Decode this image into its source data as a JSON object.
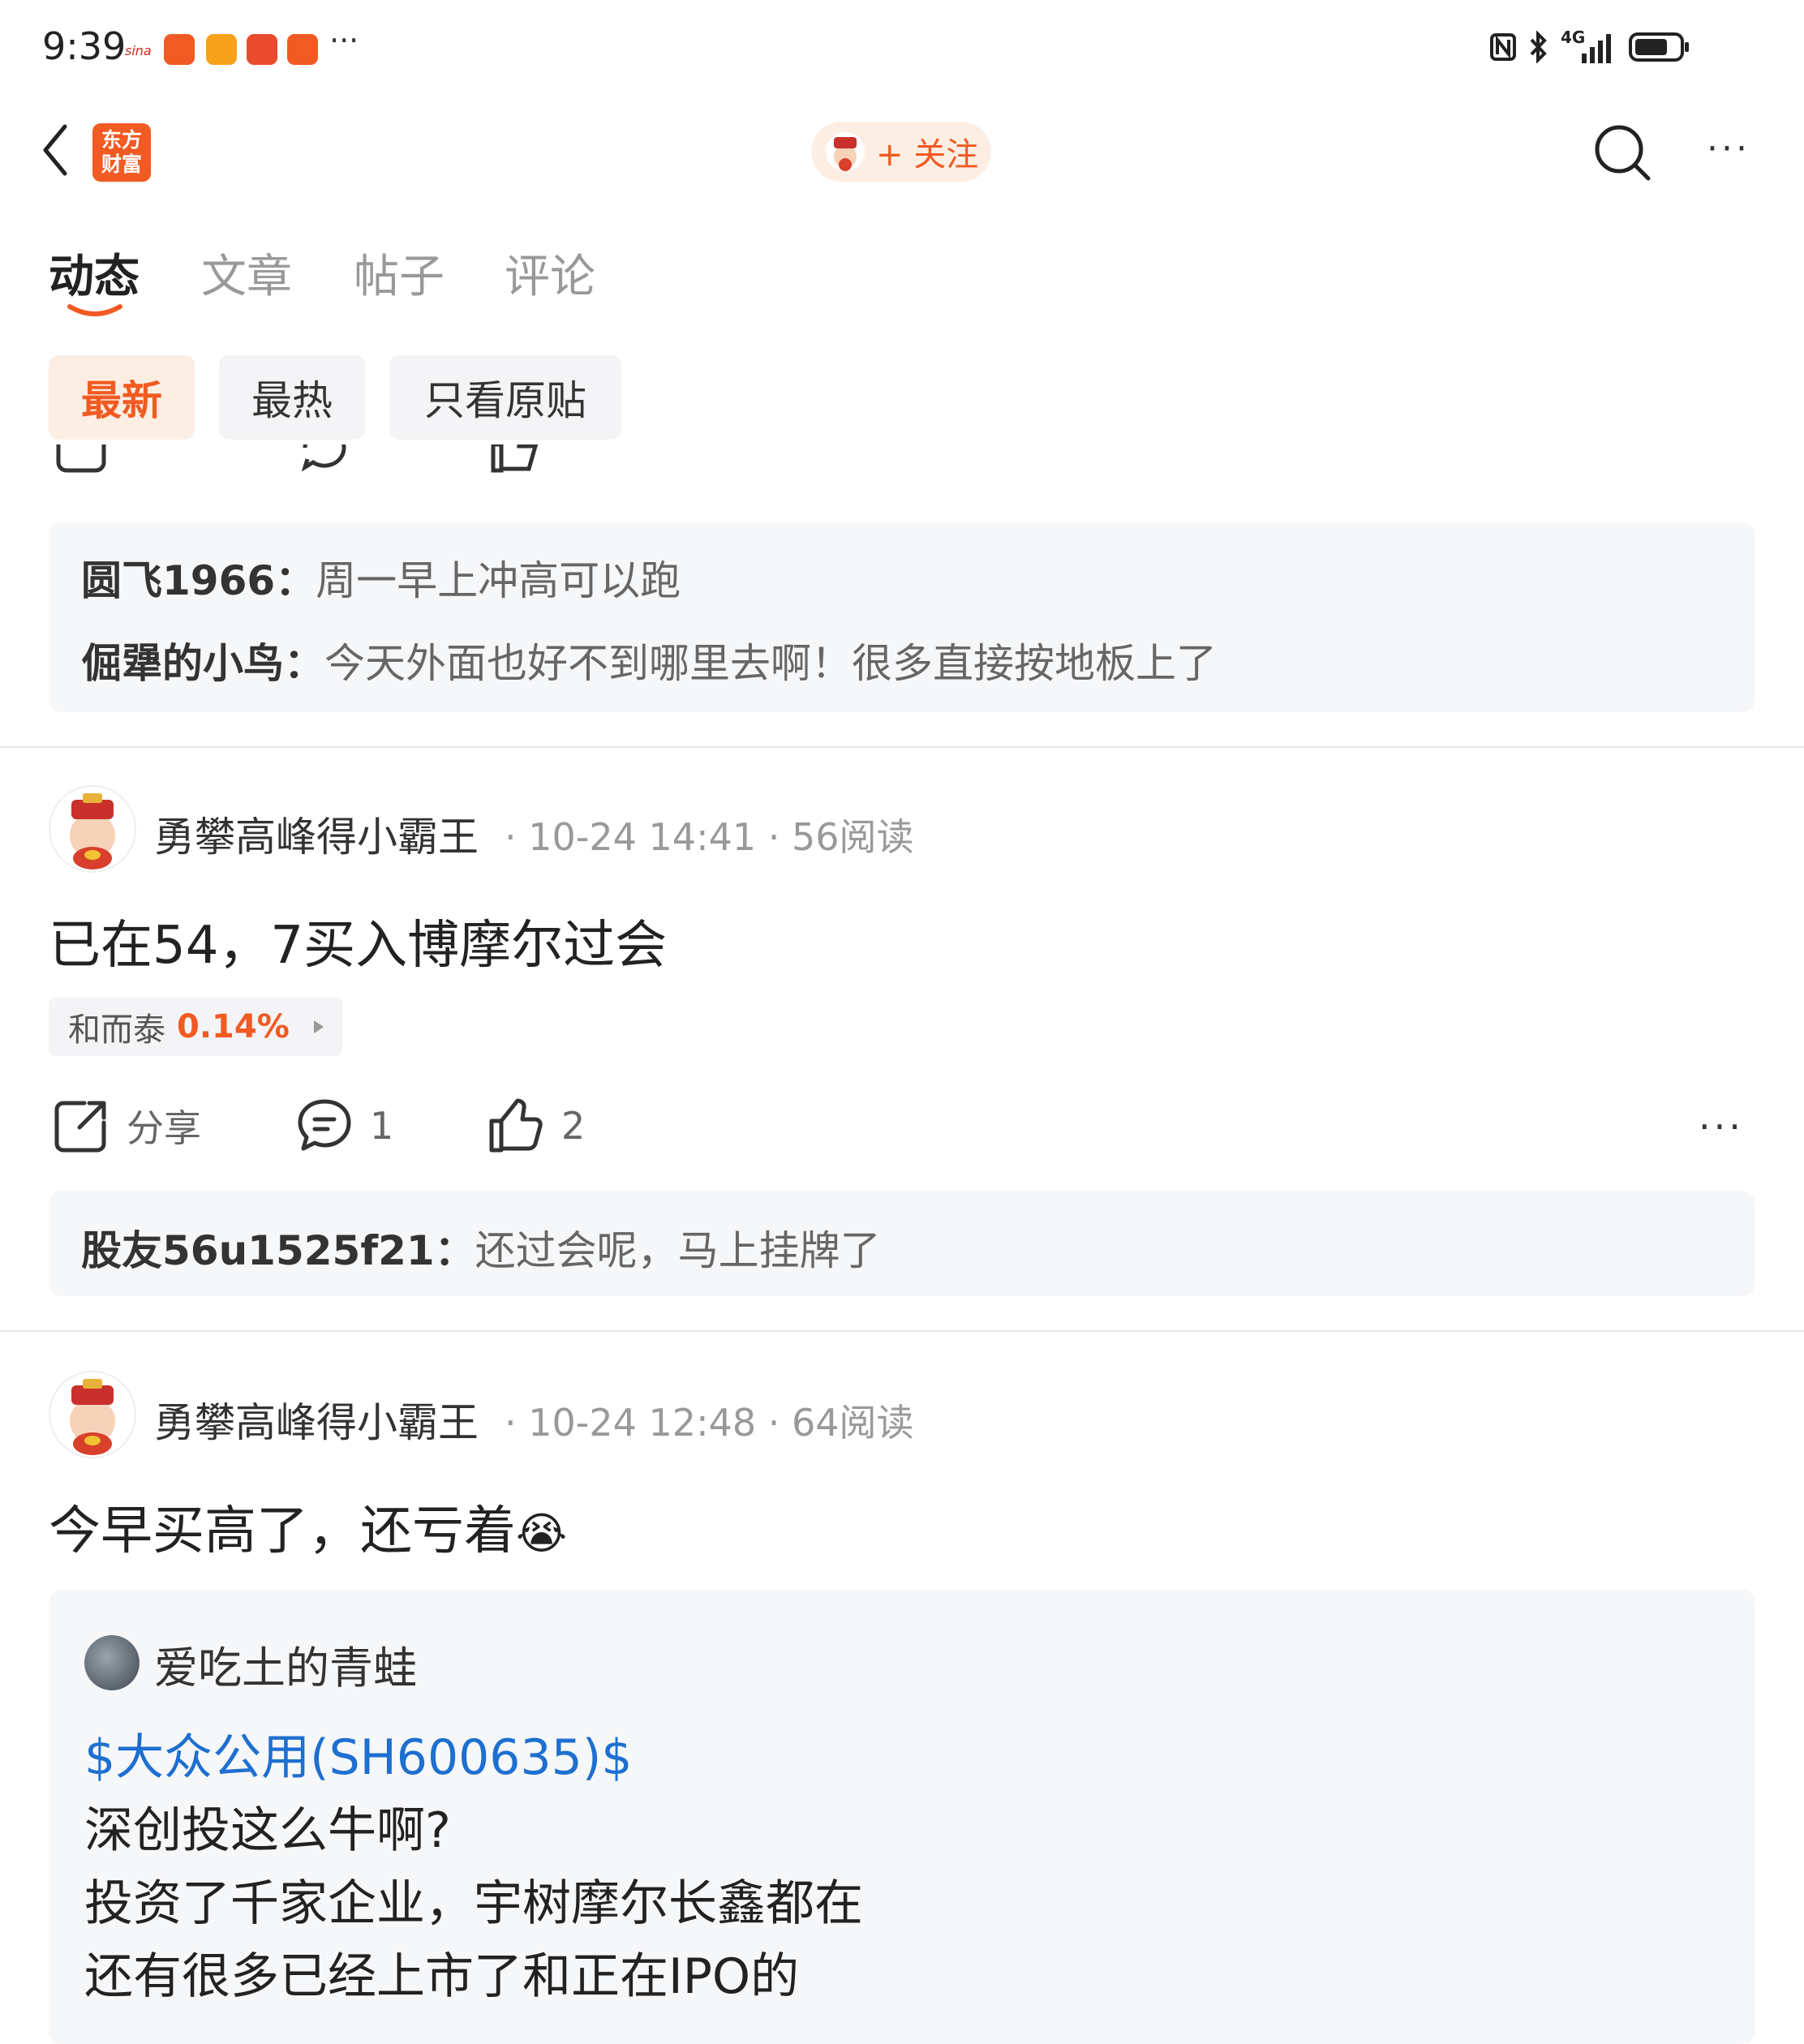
{
  "status_bar": {
    "time": "9:39",
    "notification_icons": [
      "sina-icon",
      "app-icon",
      "app-icon",
      "app-icon",
      "app-icon"
    ],
    "more": "···",
    "network": "4G",
    "battery_level": 0.75
  },
  "header": {
    "logo_text_line1": "东方",
    "logo_text_line2": "财富",
    "follow_label": "+ 关注",
    "more": "···"
  },
  "tabs": [
    {
      "label": "动态",
      "active": true
    },
    {
      "label": "文章",
      "active": false
    },
    {
      "label": "帖子",
      "active": false
    },
    {
      "label": "评论",
      "active": false
    }
  ],
  "filters": [
    {
      "label": "最新",
      "active": true
    },
    {
      "label": "最热",
      "active": false
    },
    {
      "label": "只看原贴",
      "active": false
    }
  ],
  "top_comments": [
    {
      "user": "圆飞1966",
      "sep": "：",
      "text": "周一早上冲高可以跑"
    },
    {
      "user": "倔犟的小鸟",
      "sep": "：",
      "text": "今天外面也好不到哪里去啊！很多直接按地板上了"
    }
  ],
  "posts": [
    {
      "author": "勇攀高峰得小霸王",
      "time": "10-24 14:41",
      "reads": "56阅读",
      "dot": "·",
      "text": "已在54，7买入博摩尔过会",
      "stock": {
        "name": "和而泰",
        "change": "0.14%"
      },
      "share_label": "分享",
      "comments": "1",
      "likes": "2",
      "more": "···",
      "comment": {
        "user": "股友56u1525f21",
        "sep": "：",
        "text": "还过会呢，马上挂牌了"
      }
    },
    {
      "author": "勇攀高峰得小霸王",
      "time": "10-24 12:48",
      "reads": "64阅读",
      "dot": "·",
      "text": "今早买高了，还亏着",
      "emoji": "😭",
      "quote": {
        "user": "爱吃土的青蛙",
        "link": "$大众公用(SH600635)$",
        "lines": [
          "深创投这么牛啊?",
          "投资了千家企业，宇树摩尔长鑫都在",
          "还有很多已经上市了和正在IPO的"
        ]
      }
    }
  ],
  "colors": {
    "accent": "#f15a22",
    "link": "#1d6fd0"
  }
}
